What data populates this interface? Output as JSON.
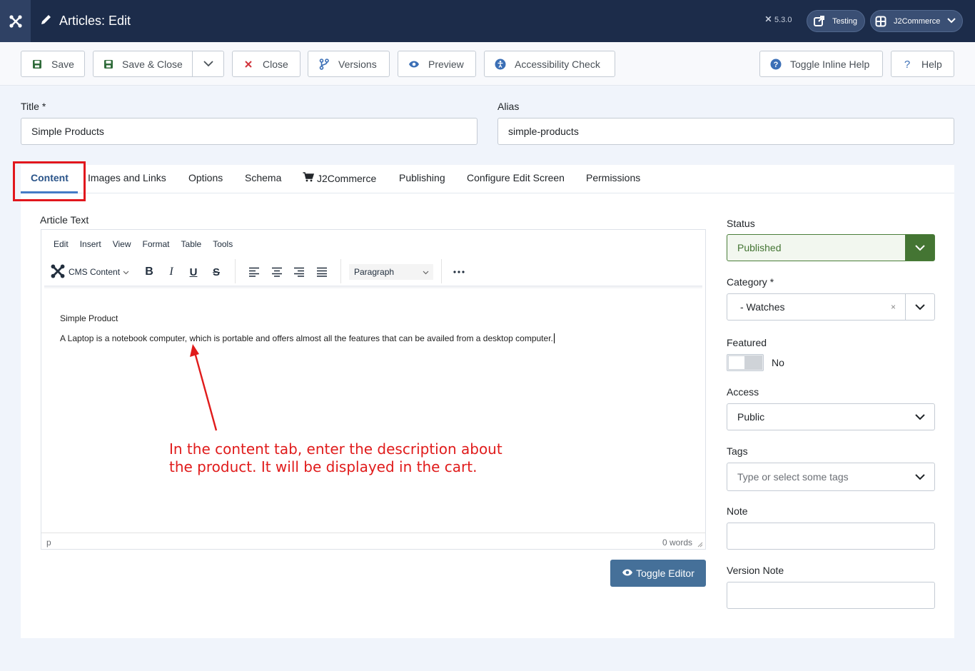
{
  "header": {
    "title": "Articles: Edit",
    "version": "5.3.0",
    "testing_label": "Testing",
    "j2commerce_label": "J2Commerce"
  },
  "toolbar": {
    "save": "Save",
    "save_close": "Save & Close",
    "close": "Close",
    "versions": "Versions",
    "preview": "Preview",
    "accessibility": "Accessibility Check",
    "toggle_inline_help": "Toggle Inline Help",
    "help": "Help"
  },
  "form": {
    "title_label": "Title *",
    "title_value": "Simple Products",
    "alias_label": "Alias",
    "alias_value": "simple-products"
  },
  "tabs": [
    "Content",
    "Images and Links",
    "Options",
    "Schema",
    "J2Commerce",
    "Publishing",
    "Configure Edit Screen",
    "Permissions"
  ],
  "editor": {
    "label": "Article Text",
    "menu": [
      "Edit",
      "Insert",
      "View",
      "Format",
      "Table",
      "Tools"
    ],
    "cms_content": "CMS Content",
    "paragraph": "Paragraph",
    "heading": "Simple Product",
    "body": "A Laptop is a notebook computer, which is portable and offers almost all the features that can be availed from a desktop computer.",
    "status_path": "p",
    "word_count": "0 words",
    "toggle_editor": "Toggle Editor"
  },
  "annotation": {
    "line1": "In the content tab, enter the description about",
    "line2": "the product. It will be displayed in the cart."
  },
  "sidebar": {
    "status_label": "Status",
    "status_value": "Published",
    "category_label": "Category *",
    "category_value": "- Watches",
    "category_clear": "×",
    "featured_label": "Featured",
    "featured_value": "No",
    "access_label": "Access",
    "access_value": "Public",
    "tags_label": "Tags",
    "tags_placeholder": "Type or select some tags",
    "note_label": "Note",
    "version_note_label": "Version Note"
  },
  "colors": {
    "header_bg": "#1c2c4a",
    "status_green": "#447533",
    "annotation_red": "#e01b1b",
    "toggle_editor_bg": "#457099"
  }
}
